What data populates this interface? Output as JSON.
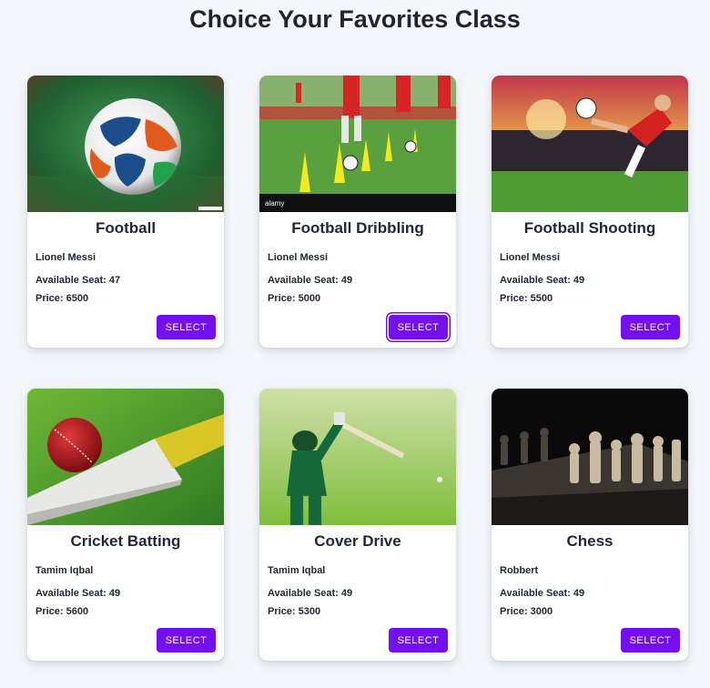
{
  "page": {
    "title": "Choice Your Favorites Class"
  },
  "select_label": "SELECT",
  "colors": {
    "accent": "#7410f0",
    "background": "#f3f6fa",
    "card": "#ffffff"
  },
  "classes": [
    {
      "name": "Football",
      "instructor": "Lionel Messi",
      "seats": "Available Seat: 47",
      "price": "Price: 6500",
      "image": "soccer-ball"
    },
    {
      "name": "Football Dribbling",
      "instructor": "Lionel Messi",
      "seats": "Available Seat: 49",
      "price": "Price: 5000",
      "image": "dribbling-cones"
    },
    {
      "name": "Football Shooting",
      "instructor": "Lionel Messi",
      "seats": "Available Seat: 49",
      "price": "Price: 5500",
      "image": "stadium-kick"
    },
    {
      "name": "Cricket Batting",
      "instructor": "Tamim Iqbal",
      "seats": "Available Seat: 49",
      "price": "Price: 5600",
      "image": "cricket-bat-ball"
    },
    {
      "name": "Cover Drive",
      "instructor": "Tamim Iqbal",
      "seats": "Available Seat: 49",
      "price": "Price: 5300",
      "image": "batsman-drive"
    },
    {
      "name": "Chess",
      "instructor": "Robbert",
      "seats": "Available Seat: 49",
      "price": "Price: 3000",
      "image": "chess-board"
    }
  ]
}
